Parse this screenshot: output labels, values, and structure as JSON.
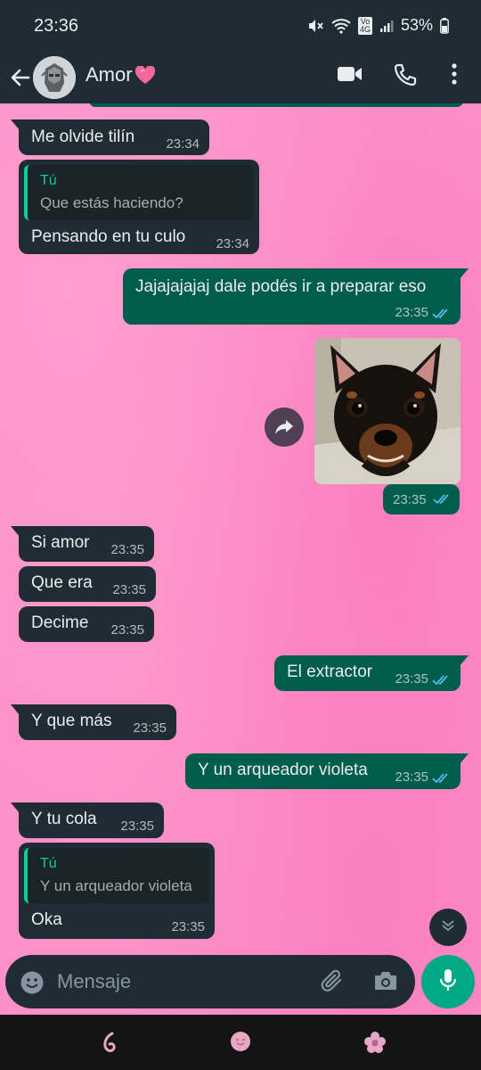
{
  "status_bar": {
    "time": "23:36",
    "battery": "53%",
    "network_badge": "Vo 4G"
  },
  "header": {
    "contact_name": "Amor",
    "icons": [
      "back-arrow-icon",
      "video-call-icon",
      "voice-call-icon",
      "more-options-icon"
    ]
  },
  "messages": [
    {
      "direction": "in",
      "text": "Me olvide tilín",
      "time": "23:34"
    },
    {
      "direction": "in",
      "quote_author": "Tú",
      "quote_text": "Que estás haciendo?",
      "text": "Pensando en tu culo",
      "time": "23:34"
    },
    {
      "direction": "out",
      "text": "Jajajajajaj dale podés ir a preparar eso",
      "time": "23:35"
    },
    {
      "direction": "out",
      "type": "sticker",
      "description_icon": "dog-sticker",
      "time": "23:35"
    },
    {
      "direction": "in",
      "text": "Si amor",
      "time": "23:35"
    },
    {
      "direction": "in",
      "text": "Que era",
      "time": "23:35"
    },
    {
      "direction": "in",
      "text": "Decime",
      "time": "23:35"
    },
    {
      "direction": "out",
      "text": "El extractor",
      "time": "23:35"
    },
    {
      "direction": "in",
      "text": "Y que más",
      "time": "23:35"
    },
    {
      "direction": "out",
      "text": "Y un arqueador violeta",
      "time": "23:35"
    },
    {
      "direction": "in",
      "text": "Y tu cola",
      "time": "23:35"
    },
    {
      "direction": "in",
      "quote_author": "Tú",
      "quote_text": "Y un arqueador violeta",
      "text": "Oka",
      "time": "23:35"
    }
  ],
  "composer": {
    "placeholder": "Mensaje"
  },
  "colors": {
    "header_bg": "#1f2c34",
    "incoming_bubble": "#202c33",
    "outgoing_bubble": "#005c4b",
    "accent": "#00a884",
    "read_ticks": "#53bdeb",
    "wallpaper": "#fb8fc8"
  }
}
